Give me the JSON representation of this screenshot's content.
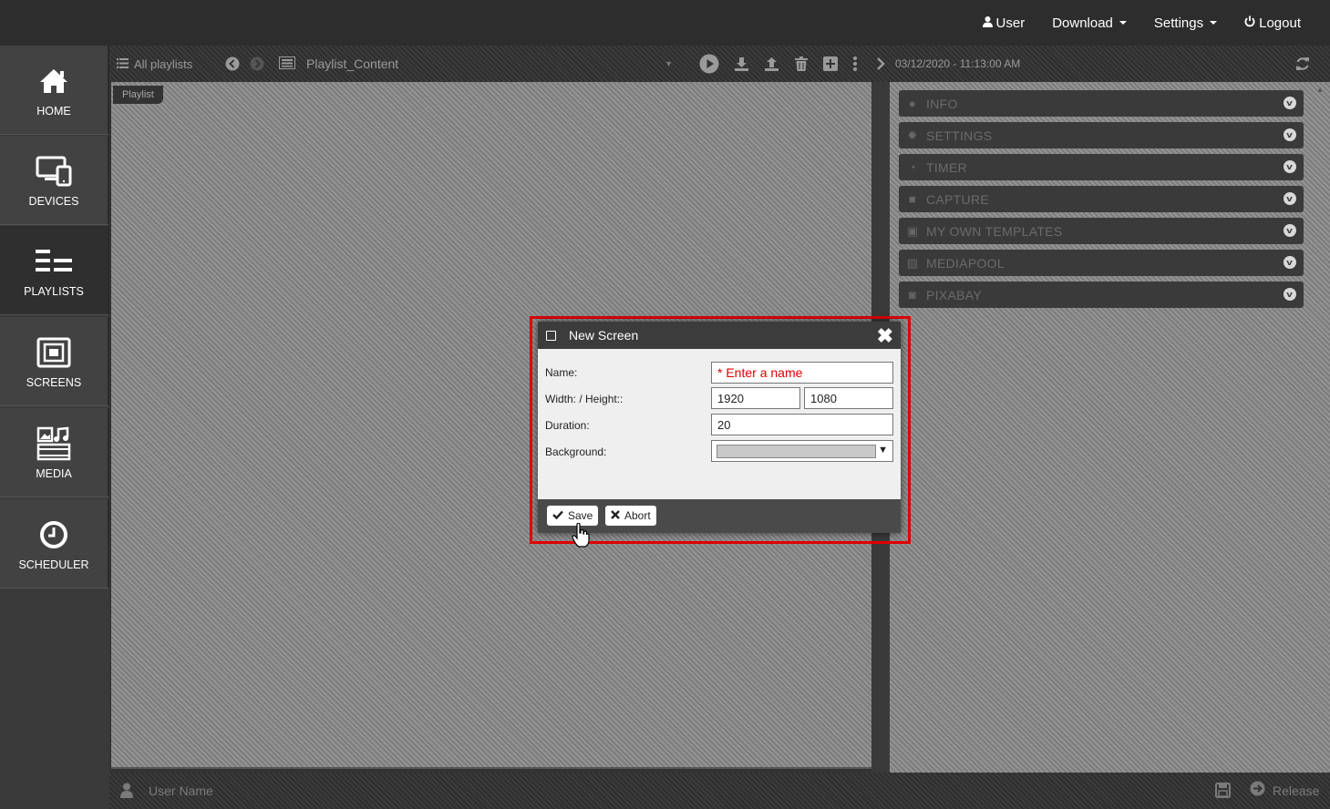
{
  "topnav": {
    "user": "User",
    "download": "Download",
    "settings": "Settings",
    "logout": "Logout"
  },
  "sidebar": {
    "items": [
      {
        "label": "HOME",
        "icon": "home-icon"
      },
      {
        "label": "DEVICES",
        "icon": "devices-icon"
      },
      {
        "label": "PLAYLISTS",
        "icon": "playlists-icon",
        "active": true
      },
      {
        "label": "SCREENS",
        "icon": "screens-icon"
      },
      {
        "label": "MEDIA",
        "icon": "media-icon"
      },
      {
        "label": "SCHEDULER",
        "icon": "clock-icon"
      }
    ]
  },
  "toolbar": {
    "all_playlists": "All playlists",
    "playlist_name": "Playlist_Content",
    "timestamp": "03/12/2020 - 11:13:00 AM"
  },
  "canvas": {
    "tab_label": "Playlist"
  },
  "right_panel": {
    "sections": [
      {
        "label": "INFO",
        "icon": "info-icon"
      },
      {
        "label": "SETTINGS",
        "icon": "gear-icon"
      },
      {
        "label": "TIMER",
        "icon": "timer-icon"
      },
      {
        "label": "CAPTURE",
        "icon": "camera-icon"
      },
      {
        "label": "MY OWN TEMPLATES",
        "icon": "templates-icon"
      },
      {
        "label": "MEDIAPOOL",
        "icon": "image-icon"
      },
      {
        "label": "PIXABAY",
        "icon": "photo-camera-icon"
      }
    ]
  },
  "bottombar": {
    "user_name": "User Name",
    "release": "Release"
  },
  "dialog": {
    "title": "New Screen",
    "name_label": "Name:",
    "name_placeholder": "* Enter a name",
    "size_label": "Width: / Height::",
    "width": "1920",
    "height": "1080",
    "duration_label": "Duration:",
    "duration": "20",
    "background_label": "Background:",
    "background_color": "#c8c8c8",
    "save": "Save",
    "abort": "Abort"
  },
  "colors": {
    "highlight": "#e00000",
    "topbar": "#2d2d2d",
    "dialog_header": "#3c3c3c"
  }
}
